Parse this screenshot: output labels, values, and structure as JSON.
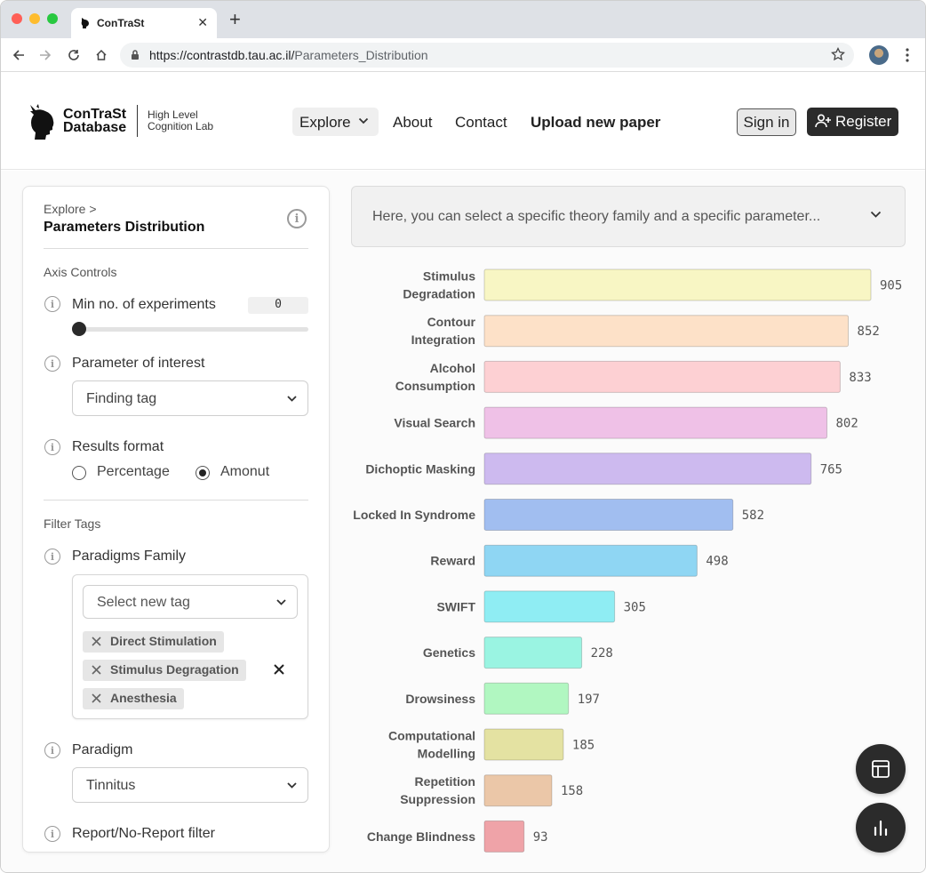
{
  "browser": {
    "tab_title": "ConTraSt",
    "url_host": "https://contrastdb.tau.ac.il/",
    "url_path": "Parameters_Distribution"
  },
  "header": {
    "logo_line1": "ConTraSt",
    "logo_line2": "Database",
    "lab_line1": "High Level",
    "lab_line2": "Cognition Lab",
    "nav": {
      "explore": "Explore",
      "about": "About",
      "contact": "Contact",
      "upload": "Upload new paper"
    },
    "sign_in": "Sign in",
    "register": "Register"
  },
  "sidebar": {
    "breadcrumb": "Explore >",
    "title": "Parameters Distribution",
    "axis_controls_label": "Axis Controls",
    "min_experiments_label": "Min no. of experiments",
    "min_experiments_value": "0",
    "slider_value": 0,
    "parameter_label": "Parameter of interest",
    "parameter_value": "Finding tag",
    "results_format_label": "Results format",
    "format_options": [
      "Percentage",
      "Amonut"
    ],
    "format_selected": "Amonut",
    "filter_tags_label": "Filter Tags",
    "paradigms_family_label": "Paradigms Family",
    "tag_select_placeholder": "Select new tag",
    "selected_tags": [
      "Direct Stimulation",
      "Stimulus Degragation",
      "Anesthesia"
    ],
    "paradigm_label": "Paradigm",
    "paradigm_value": "Tinnitus",
    "report_filter_label": "Report/No-Report filter"
  },
  "description": "Here, you can select a specific theory family and a specific parameter...",
  "chart_data": {
    "type": "bar",
    "orientation": "horizontal",
    "categories": [
      "Stimulus Degradation",
      "Contour Integration",
      "Alcohol Consumption",
      "Visual Search",
      "Dichoptic Masking",
      "Locked In Syndrome",
      "Reward",
      "SWIFT",
      "Genetics",
      "Drowsiness",
      "Computational Modelling",
      "Repetition Suppression",
      "Change Blindness"
    ],
    "values": [
      905,
      852,
      833,
      802,
      765,
      582,
      498,
      305,
      228,
      197,
      185,
      158,
      93
    ],
    "colors": [
      "#f8f6c4",
      "#fde1c8",
      "#fdd0d3",
      "#efc1e7",
      "#cdbaef",
      "#a1bef0",
      "#8fd6f3",
      "#8fedf3",
      "#9af4e2",
      "#b1f7c1",
      "#e4e2a2",
      "#ebc7a8",
      "#efa3a8"
    ],
    "xlim": [
      0,
      905
    ],
    "grid": false,
    "legend": "none"
  },
  "colors": {
    "accent_dark": "#2b2b2b"
  }
}
